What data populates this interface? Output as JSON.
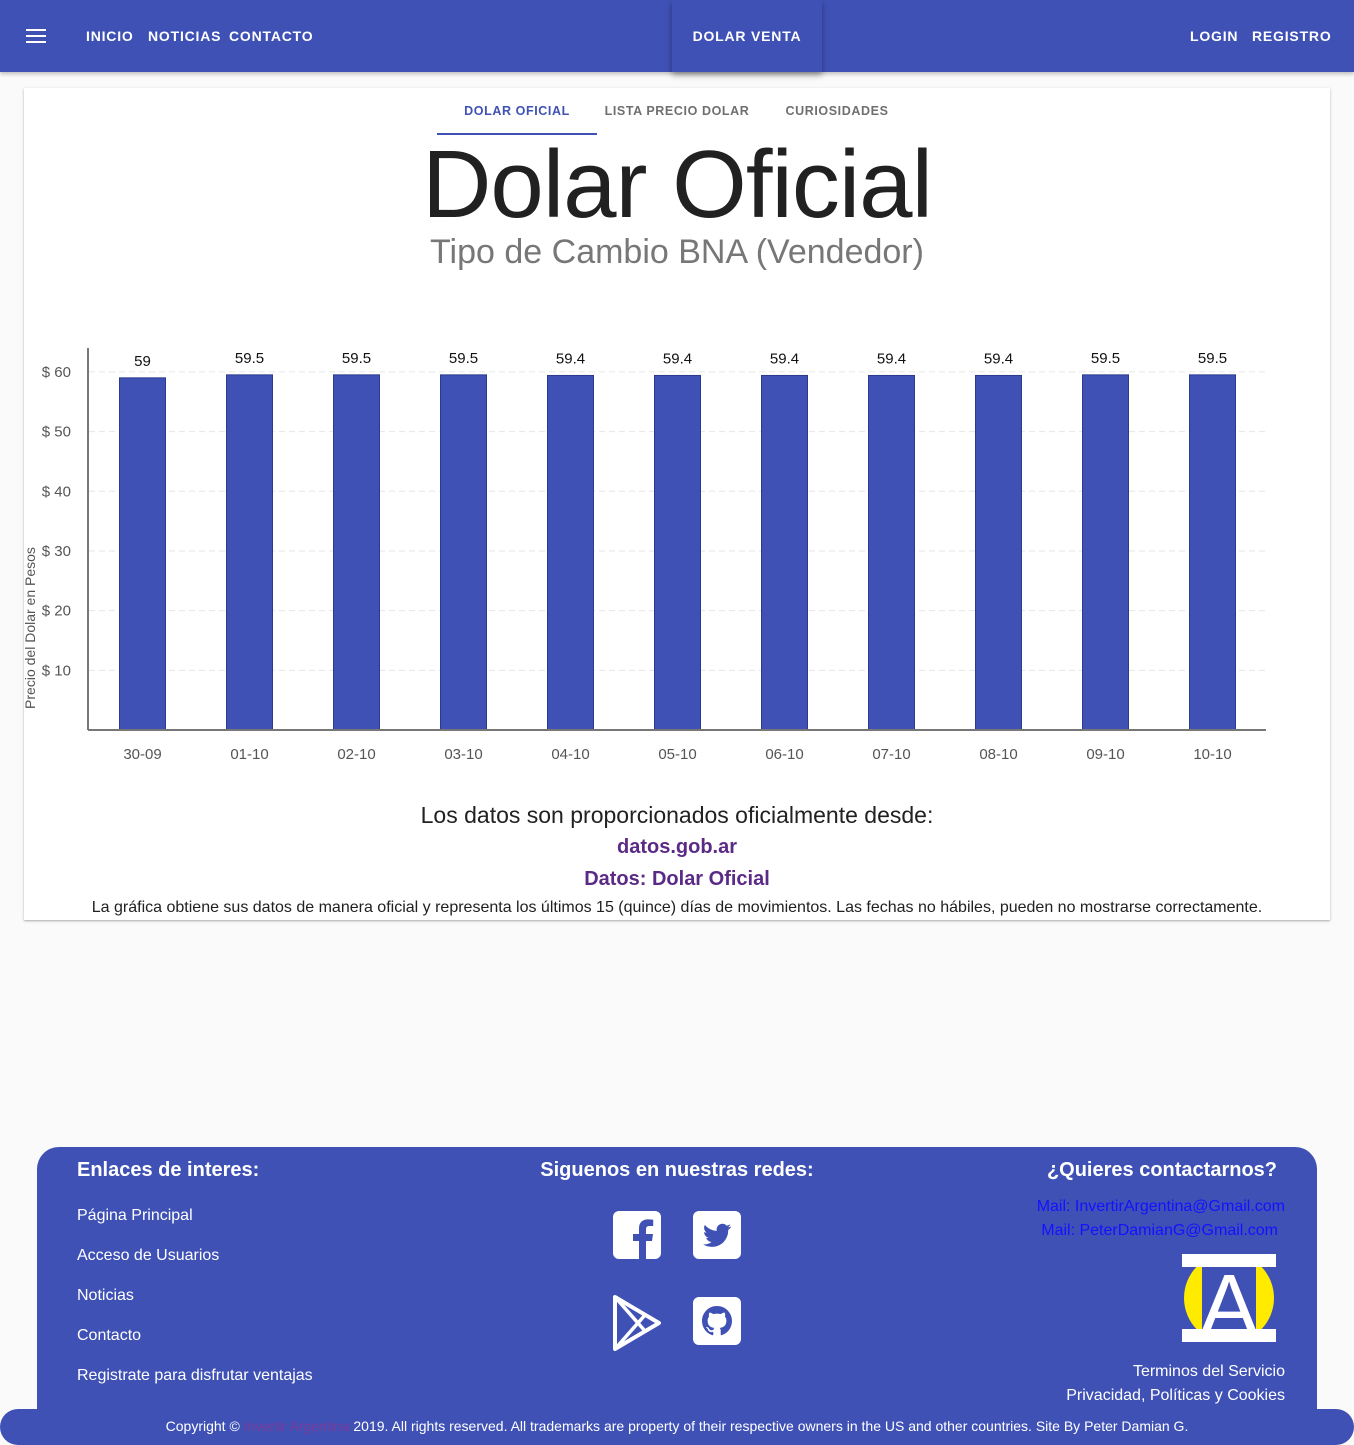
{
  "nav": {
    "left": [
      "INICIO",
      "NOTICIAS",
      "CONTACTO"
    ],
    "center": "DOLAR VENTA",
    "right": [
      "LOGIN",
      "REGISTRO"
    ]
  },
  "tabs": [
    "DOLAR OFICIAL",
    "LISTA PRECIO DOLAR",
    "CURIOSIDADES"
  ],
  "active_tab": "DOLAR OFICIAL",
  "header": {
    "title": "Dolar Oficial",
    "subtitle": "Tipo de Cambio BNA (Vendedor)"
  },
  "chart_data": {
    "type": "bar",
    "categories": [
      "30-09",
      "01-10",
      "02-10",
      "03-10",
      "04-10",
      "05-10",
      "06-10",
      "07-10",
      "08-10",
      "09-10",
      "10-10"
    ],
    "values": [
      59,
      59.5,
      59.5,
      59.5,
      59.4,
      59.4,
      59.4,
      59.4,
      59.4,
      59.5,
      59.5
    ],
    "data_labels": [
      "59",
      "59.5",
      "59.5",
      "59.5",
      "59.4",
      "59.4",
      "59.4",
      "59.4",
      "59.4",
      "59.5",
      "59.5"
    ],
    "ylabel": "Precio del Dolar en Pesos",
    "yticks": [
      "$ 10",
      "$ 20",
      "$ 30",
      "$ 40",
      "$ 50",
      "$ 60"
    ],
    "ytick_values": [
      10,
      20,
      30,
      40,
      50,
      60
    ],
    "ylim": [
      0,
      64
    ],
    "grid": true,
    "bar_color": "#3f51b5"
  },
  "source": {
    "intro": "Los datos son proporcionados oficialmente desde:",
    "link1": "datos.gob.ar",
    "link2": "Datos: Dolar Oficial",
    "note": "La gráfica obtiene sus datos de manera oficial y representa los últimos 15 (quince) días de movimientos. Las fechas no hábiles, pueden no mostrarse correctamente."
  },
  "footer": {
    "links_title": "Enlaces de interes:",
    "links": [
      "Página Principal",
      "Acceso de Usuarios",
      "Noticias",
      "Contacto",
      "Registrate para disfrutar ventajas"
    ],
    "social_title": "Siguenos en nuestras redes:",
    "social_icons": [
      "facebook-icon",
      "twitter-icon",
      "google-play-icon",
      "github-icon"
    ],
    "contact_title": "¿Quieres contactarnos?",
    "mail1": "Mail: InvertirArgentina@Gmail.com",
    "mail2": "Mail: PeterDamianG@Gmail.com",
    "terms": "Terminos del Servicio",
    "privacy": "Privacidad, Políticas y Cookies",
    "logo_letter": "A"
  },
  "copyright": {
    "prefix": "Copyright © ",
    "brand": "Invertir Argentina",
    "suffix": " 2019. All rights reserved. All trademarks are property of their respective owners in the US and other countries. Site By Peter Damian G."
  }
}
